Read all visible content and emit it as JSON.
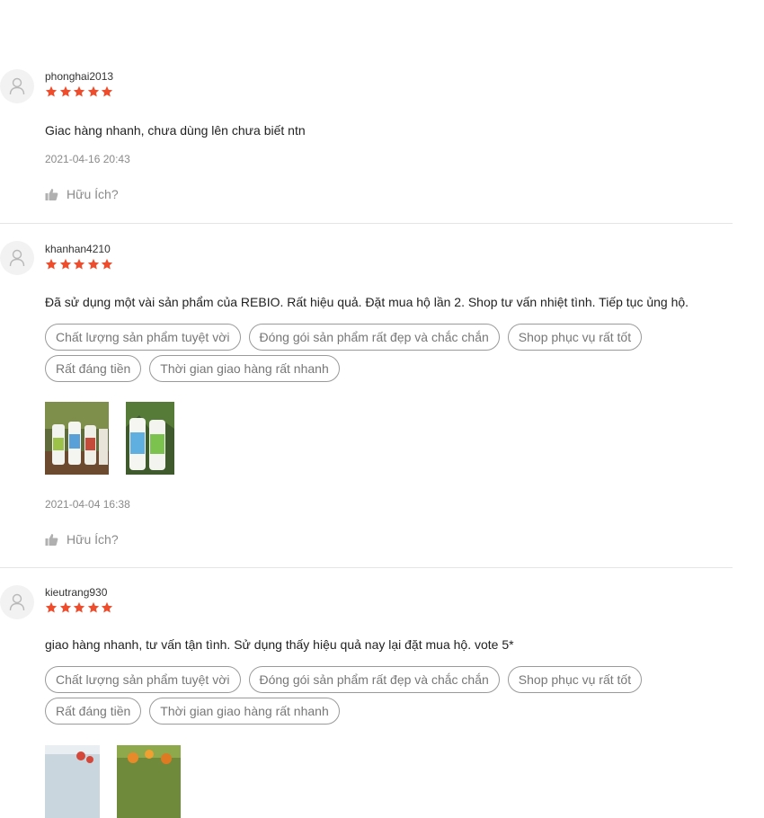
{
  "colors": {
    "star": "#ee4d2d",
    "muted_text": "#8a8a8a",
    "tag_border": "#9a9a9a"
  },
  "icons": {
    "avatar": "user-avatar-icon",
    "star": "star-icon",
    "helpful": "thumbs-up-icon"
  },
  "reviews": [
    {
      "username": "phonghai2013",
      "rating": 5,
      "text": "Giac hàng nhanh, chưa dùng lên chưa biết ntn",
      "tags": [],
      "photo_count": 0,
      "date": "2021-04-16 20:43",
      "helpful_label": "Hữu Ích?"
    },
    {
      "username": "khanhan4210",
      "rating": 5,
      "text": "Đã sử dụng một vài sản phẩm của REBIO. Rất hiệu quả. Đặt mua hộ lần 2. Shop tư vấn nhiệt tình. Tiếp tục ủng hộ.",
      "tags": [
        "Chất lượng sản phẩm tuyệt vời",
        "Đóng gói sản phẩm rất đẹp và chắc chắn",
        "Shop phục vụ rất tốt",
        "Rất đáng tiền",
        "Thời gian giao hàng rất nhanh"
      ],
      "photo_count": 2,
      "date": "2021-04-04 16:38",
      "helpful_label": "Hữu Ích?"
    },
    {
      "username": "kieutrang930",
      "rating": 5,
      "text": "giao hàng nhanh, tư vấn tận tình. Sử dụng thấy hiệu quả nay lại đặt mua hộ. vote 5*",
      "tags": [
        "Chất lượng sản phẩm tuyệt vời",
        "Đóng gói sản phẩm rất đẹp và chắc chắn",
        "Shop phục vụ rất tốt",
        "Rất đáng tiền",
        "Thời gian giao hàng rất nhanh"
      ],
      "photo_count": 2,
      "date": "",
      "helpful_label": ""
    }
  ]
}
